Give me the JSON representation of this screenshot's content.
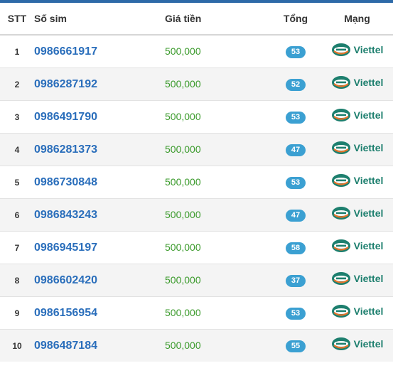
{
  "header": {
    "stt": "STT",
    "sim": "Số sim",
    "price": "Giá tiền",
    "total": "Tổng",
    "network": "Mạng"
  },
  "colors": {
    "accent": "#2d6aa8",
    "link": "#2a6ebb",
    "price": "#3a9a2b",
    "badge": "#3ba0d2",
    "carrier": "#1d7f6e"
  },
  "rows": [
    {
      "stt": "1",
      "sim": "0986661917",
      "price": "500,000",
      "total": "53",
      "network": "Viettel",
      "icon": "viettel-logo-icon"
    },
    {
      "stt": "2",
      "sim": "0986287192",
      "price": "500,000",
      "total": "52",
      "network": "Viettel",
      "icon": "viettel-logo-icon"
    },
    {
      "stt": "3",
      "sim": "0986491790",
      "price": "500,000",
      "total": "53",
      "network": "Viettel",
      "icon": "viettel-logo-icon"
    },
    {
      "stt": "4",
      "sim": "0986281373",
      "price": "500,000",
      "total": "47",
      "network": "Viettel",
      "icon": "viettel-logo-icon"
    },
    {
      "stt": "5",
      "sim": "0986730848",
      "price": "500,000",
      "total": "53",
      "network": "Viettel",
      "icon": "viettel-logo-icon"
    },
    {
      "stt": "6",
      "sim": "0986843243",
      "price": "500,000",
      "total": "47",
      "network": "Viettel",
      "icon": "viettel-logo-icon"
    },
    {
      "stt": "7",
      "sim": "0986945197",
      "price": "500,000",
      "total": "58",
      "network": "Viettel",
      "icon": "viettel-logo-icon"
    },
    {
      "stt": "8",
      "sim": "0986602420",
      "price": "500,000",
      "total": "37",
      "network": "Viettel",
      "icon": "viettel-logo-icon"
    },
    {
      "stt": "9",
      "sim": "0986156954",
      "price": "500,000",
      "total": "53",
      "network": "Viettel",
      "icon": "viettel-logo-icon"
    },
    {
      "stt": "10",
      "sim": "0986487184",
      "price": "500,000",
      "total": "55",
      "network": "Viettel",
      "icon": "viettel-logo-icon"
    }
  ]
}
